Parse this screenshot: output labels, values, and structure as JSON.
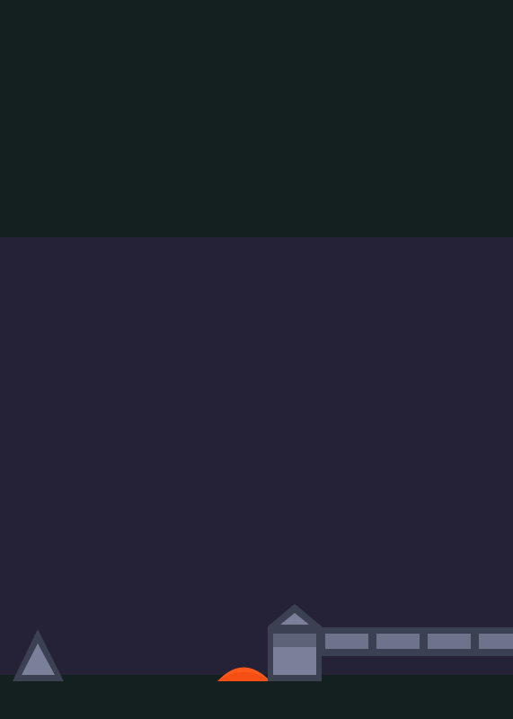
{
  "scene": {
    "colors": {
      "sky_top": "#14201f",
      "backdrop": "#252237",
      "ground": "#14201f",
      "block_outline": "#3b4052",
      "block_fill": "#7a8099",
      "block_fill_dark": "#5c6378",
      "hazard": "#ff5a1a",
      "hazard_edge": "#e64310"
    },
    "objects": [
      {
        "kind": "spike",
        "icon": "spike-icon"
      },
      {
        "kind": "jump-pad",
        "icon": "jump-pad-icon"
      },
      {
        "kind": "pillar-block",
        "icon": "block-icon"
      },
      {
        "kind": "platform-segment",
        "count": 4
      }
    ]
  }
}
